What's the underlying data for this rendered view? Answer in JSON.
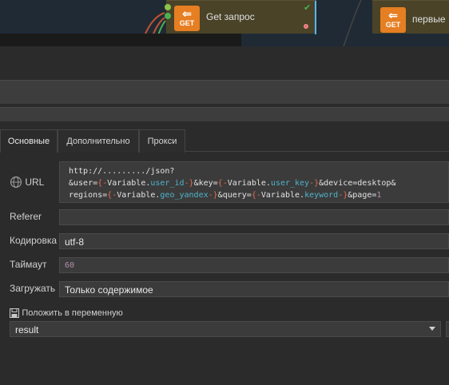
{
  "canvas": {
    "node1": {
      "badge": "GET",
      "title": "Get запрос"
    },
    "node2": {
      "badge": "GET",
      "title": "первые"
    }
  },
  "tabs": [
    {
      "label": "Основные",
      "active": true
    },
    {
      "label": "Дополнительно",
      "active": false
    },
    {
      "label": "Прокси",
      "active": false
    }
  ],
  "form": {
    "url": {
      "label": "URL",
      "icon": "globe-icon",
      "value": "http://........./json?&user={-Variable.user_id-}&key={-Variable.user_key-}&device=desktop&regions={-Variable.geo_yandex-}&query={-Variable.keyword-}&page=1",
      "lines": [
        [
          {
            "t": "http://........./json?",
            "c": "plain"
          }
        ],
        [
          {
            "t": "&user=",
            "c": "plain"
          },
          {
            "t": "{-",
            "c": "br"
          },
          {
            "t": "Variable.",
            "c": "plain"
          },
          {
            "t": "user_id",
            "c": "var"
          },
          {
            "t": "-}",
            "c": "br"
          },
          {
            "t": "&key=",
            "c": "plain"
          },
          {
            "t": "{-",
            "c": "br"
          },
          {
            "t": "Variable.",
            "c": "plain"
          },
          {
            "t": "user_key",
            "c": "var"
          },
          {
            "t": "-}",
            "c": "br"
          },
          {
            "t": "&device=desktop&",
            "c": "plain"
          }
        ],
        [
          {
            "t": "regions=",
            "c": "plain"
          },
          {
            "t": "{-",
            "c": "br"
          },
          {
            "t": "Variable.",
            "c": "plain"
          },
          {
            "t": "geo_yandex",
            "c": "var"
          },
          {
            "t": "-}",
            "c": "br"
          },
          {
            "t": "&query=",
            "c": "plain"
          },
          {
            "t": "{-",
            "c": "br"
          },
          {
            "t": "Variable.",
            "c": "plain"
          },
          {
            "t": "keyword",
            "c": "var"
          },
          {
            "t": "-}",
            "c": "br"
          },
          {
            "t": "&page=",
            "c": "plain"
          },
          {
            "t": "1",
            "c": "num"
          }
        ]
      ]
    },
    "referer": {
      "label": "Referer",
      "value": ""
    },
    "encoding": {
      "label": "Кодировка",
      "value": "utf-8"
    },
    "timeout": {
      "label": "Таймаут",
      "value": "60"
    },
    "load": {
      "label": "Загружать",
      "value": "Только содержимое"
    },
    "save_to_variable": {
      "label": "Положить в переменную",
      "icon": "floppy-icon"
    },
    "result_select": {
      "value": "result"
    }
  },
  "colors": {
    "accent_orange": "#e67e22",
    "var_cyan": "#4fb3c9",
    "brace_red": "#e06c50",
    "number_purple": "#b48ead"
  }
}
